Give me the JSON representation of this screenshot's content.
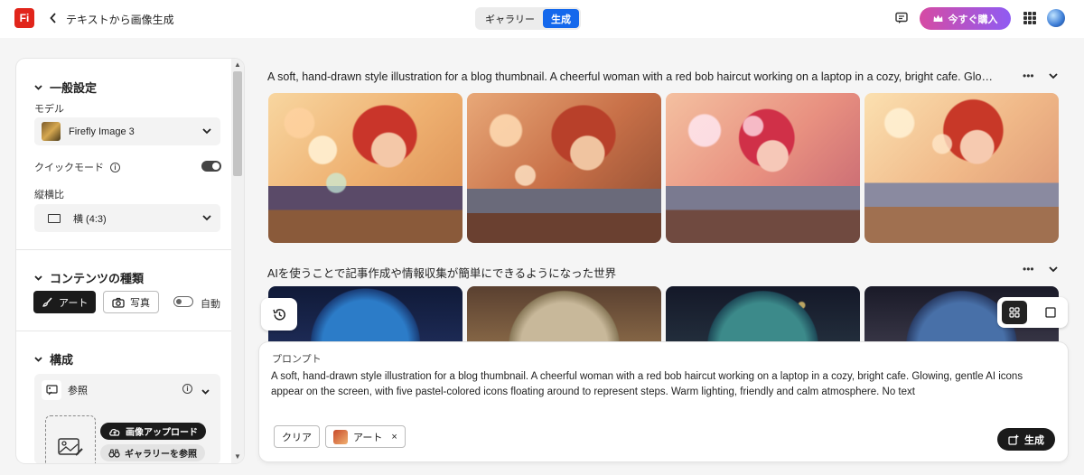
{
  "app": {
    "logo_text": "Fi",
    "title": "テキストから画像生成"
  },
  "nav": {
    "tabs": [
      {
        "label": "ギャラリー",
        "active": false
      },
      {
        "label": "生成",
        "active": true
      }
    ]
  },
  "header": {
    "buy_label": "今すぐ購入"
  },
  "colors": {
    "accent": "#1468ec",
    "buy_start": "#d64ba3",
    "buy_end": "#8f5bf3",
    "logo": "#e1251b"
  },
  "sidebar": {
    "general": {
      "title": "一般設定",
      "model_label": "モデル",
      "model_value": "Firefly Image 3",
      "quick_mode_label": "クイックモード",
      "quick_mode_on": true,
      "ratio_label": "縦横比",
      "ratio_value": "横 (4:3)"
    },
    "content": {
      "title": "コンテンツの種類",
      "art_label": "アート",
      "photo_label": "写真",
      "auto_label": "自動",
      "auto_on": false
    },
    "composition": {
      "title": "構成",
      "reference_label": "参照",
      "upload_label": "画像アップロード",
      "gallery_label": "ギャラリーを参照"
    }
  },
  "results": [
    {
      "prompt": "A soft, hand-drawn style illustration for a blog thumbnail. A cheerful woman with a red bob haircut working on a laptop in a cozy, bright cafe. Glo…",
      "more": "•••"
    },
    {
      "prompt": "AIを使うことで記事作成や情報収集が簡単にできるようになった世界",
      "more": "•••"
    }
  ],
  "prompt_box": {
    "label": "プロンプト",
    "text": "A soft, hand-drawn style illustration for a blog thumbnail. A cheerful woman with a red bob haircut working on a laptop in a cozy, bright cafe. Glowing, gentle AI icons appear on the screen, with five pastel-colored icons floating around to represent steps. Warm lighting, friendly and calm atmosphere. No text",
    "clear_label": "クリア",
    "style_chip_label": "アート",
    "chip_close": "×",
    "generate_label": "生成"
  }
}
